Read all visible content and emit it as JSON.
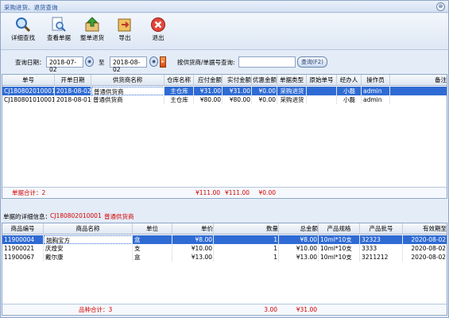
{
  "window": {
    "title": "采购进货、退货查询",
    "close_glyph": "⊗"
  },
  "toolbar": {
    "items": [
      {
        "label": "详细查找",
        "icon": "magnifier-icon"
      },
      {
        "label": "查看单据",
        "icon": "document-search-icon"
      },
      {
        "label": "整单退货",
        "icon": "return-icon"
      },
      {
        "label": "导出",
        "icon": "export-icon"
      },
      {
        "label": "退出",
        "icon": "exit-icon"
      }
    ]
  },
  "filter": {
    "date_label": "查询日期：",
    "date_from": "2018-07-02",
    "to_label": "至",
    "date_to": "2018-08-02",
    "supplier_label": "按供货商/单据号查询:",
    "search_value": "",
    "query_button": "查询(F2)"
  },
  "orders": {
    "columns": [
      "单号",
      "开单日期",
      "供货商名称",
      "仓库名称",
      "应付金额",
      "实付金额",
      "优惠金额",
      "单据类型",
      "原始单号",
      "经办人",
      "操作员",
      "备注"
    ],
    "rows": [
      [
        "CJ180802010001",
        "2018-08-02",
        "普通供货商",
        "主仓库",
        "¥31.00",
        "¥31.00",
        "¥0.00",
        "采购进货",
        "",
        "小磊",
        "admin",
        ""
      ],
      [
        "CJ180801010001",
        "2018-08-01",
        "普通供货商",
        "主仓库",
        "¥80.00",
        "¥80.00",
        "¥0.00",
        "采购进货",
        "",
        "小磊",
        "admin",
        ""
      ]
    ],
    "selected_index": 0,
    "footer": {
      "count_label": "单据合计：2",
      "payable": "¥111.00",
      "paid": "¥111.00",
      "discount": "¥0.00"
    }
  },
  "detail": {
    "label": "单据的详细信息：",
    "order_no": "CJ180802010001",
    "supplier": "普通供货商"
  },
  "items": {
    "columns": [
      "商品编号",
      "商品名称",
      "单位",
      "单价",
      "数量",
      "总金额",
      "产品规格",
      "产品批号",
      "有效期至"
    ],
    "rows": [
      [
        "11900004",
        "翘胸宝方",
        "盒",
        "¥8.00",
        "1",
        "¥8.00",
        "10ml*10支",
        "32323",
        "2020-08-02"
      ],
      [
        "11900021",
        "庆煌安",
        "支",
        "¥10.00",
        "1",
        "¥10.00",
        "10ml*10支",
        "3333",
        "2020-08-02"
      ],
      [
        "11900067",
        "戴尔康",
        "盒",
        "¥13.00",
        "1",
        "¥13.00",
        "10ml*10支",
        "3211212",
        "2020-08-02"
      ]
    ],
    "selected_index": 0,
    "footer": {
      "count_label": "品种合计：3",
      "qty": "3.00",
      "amount": "¥31.00"
    }
  },
  "colors": {
    "selection": "#2f6bd4",
    "accent_red": "#d40000"
  }
}
